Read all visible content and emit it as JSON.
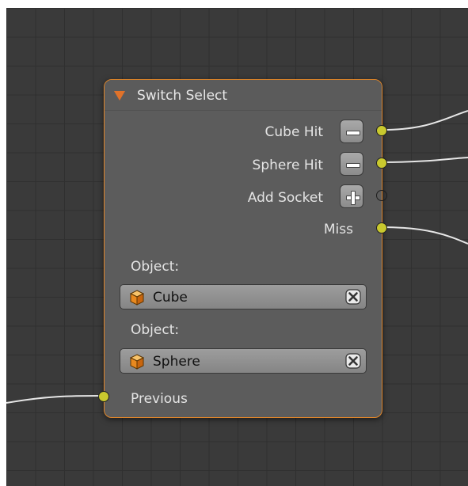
{
  "node": {
    "title": "Switch Select",
    "outputs": [
      {
        "label": "Cube Hit",
        "button": "remove"
      },
      {
        "label": "Sphere Hit",
        "button": "remove"
      },
      {
        "label": "Add Socket",
        "button": "add"
      },
      {
        "label": "Miss"
      }
    ],
    "objects": [
      {
        "label": "Object:",
        "value": "Cube"
      },
      {
        "label": "Object:",
        "value": "Sphere"
      }
    ],
    "input": {
      "label": "Previous"
    }
  },
  "colors": {
    "frame_accent": "#e0862a",
    "socket": "#c9c92e",
    "canvas_bg": "#3a3a3a",
    "node_body": "#5c5c5c"
  },
  "icons": [
    "collapse-triangle-icon",
    "minus-icon",
    "plus-icon",
    "cube-object-icon",
    "clear-x-icon"
  ]
}
